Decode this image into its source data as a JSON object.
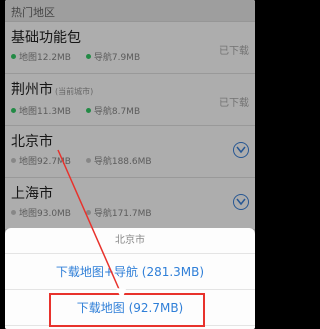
{
  "section_header": "热门地区",
  "rows": [
    {
      "city": "基础功能包",
      "current_tag": "",
      "map_label": "地图12.2MB",
      "nav_label": "导航7.9MB",
      "status": "已下载"
    },
    {
      "city": "荆州市",
      "current_tag": "(当前城市)",
      "map_label": "地图11.3MB",
      "nav_label": "导航8.7MB",
      "status": "已下载"
    },
    {
      "city": "北京市",
      "current_tag": "",
      "map_label": "地图92.7MB",
      "nav_label": "导航188.6MB",
      "status": ""
    },
    {
      "city": "上海市",
      "current_tag": "",
      "map_label": "地图93.0MB",
      "nav_label": "导航171.7MB",
      "status": ""
    }
  ],
  "sheet": {
    "title": "北京市",
    "option_map_nav": "下载地图+导航 (281.3MB)",
    "option_map_only": "下载地图 (92.7MB)"
  },
  "colors": {
    "accent_blue": "#2f7fd8",
    "downloaded_dot": "#33cc66",
    "highlight_red": "#e8322c"
  },
  "icons": [
    "download-icon"
  ]
}
